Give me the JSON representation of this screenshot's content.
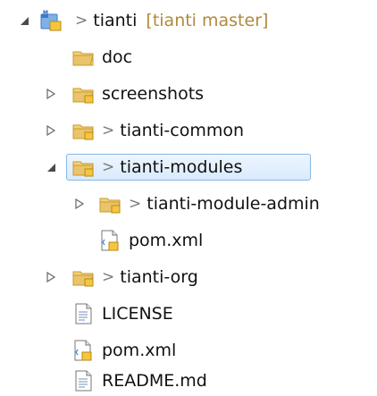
{
  "tree": {
    "root": {
      "gt": ">",
      "name": "tianti",
      "repo": "[tianti master]"
    },
    "doc": {
      "name": "doc"
    },
    "screenshots": {
      "name": "screenshots"
    },
    "common": {
      "gt": ">",
      "name": "tianti-common"
    },
    "modules": {
      "gt": ">",
      "name": "tianti-modules"
    },
    "module_admin": {
      "gt": ">",
      "name": "tianti-module-admin"
    },
    "modules_pom": {
      "name": "pom.xml"
    },
    "org": {
      "gt": ">",
      "name": "tianti-org"
    },
    "license": {
      "name": "LICENSE"
    },
    "root_pom": {
      "name": "pom.xml"
    },
    "readme": {
      "name": "README.md"
    }
  },
  "colors": {
    "folder": "#e9c46a",
    "folder_dark": "#c99a2e",
    "selection_border": "#86b7e6",
    "selection_fill": "#d9eafc",
    "repo_text": "#b08a3c",
    "twisty": "#555555"
  },
  "icons": {
    "expanded": "triangle-expanded-icon",
    "collapsed": "triangle-collapsed-icon",
    "project": "maven-project-icon",
    "folder": "folder-icon",
    "package_folder": "source-folder-icon",
    "xml": "pom-xml-icon",
    "text": "text-file-icon"
  }
}
